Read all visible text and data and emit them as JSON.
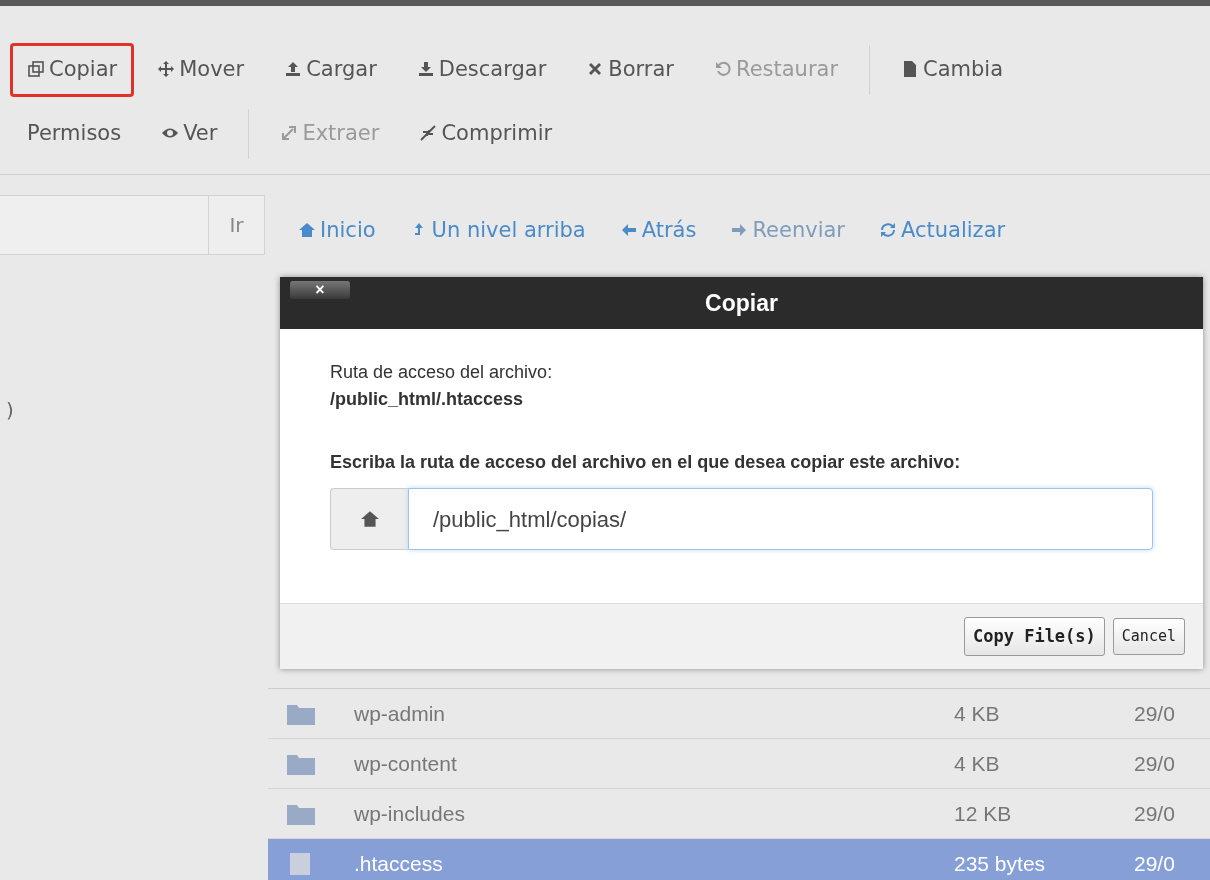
{
  "toolbar": {
    "rows": [
      [
        {
          "label": "Copiar",
          "kind": "copy",
          "disabled": false,
          "highlighted": true
        },
        {
          "label": "Mover",
          "kind": "move",
          "disabled": false,
          "highlighted": false
        },
        {
          "label": "Cargar",
          "kind": "upload",
          "disabled": false,
          "highlighted": false
        },
        {
          "label": "Descargar",
          "kind": "download",
          "disabled": false,
          "highlighted": false
        },
        {
          "label": "Borrar",
          "kind": "delete",
          "disabled": false,
          "highlighted": false
        },
        {
          "label": "Restaurar",
          "kind": "restore",
          "disabled": true,
          "highlighted": false
        },
        {
          "label": "Cambia",
          "kind": "file",
          "disabled": false,
          "highlighted": false
        }
      ],
      [
        {
          "label": "Permisos",
          "kind": "permissions",
          "disabled": false,
          "highlighted": false
        },
        {
          "label": "Ver",
          "kind": "view",
          "disabled": false,
          "highlighted": false
        },
        {
          "label": "Extraer",
          "kind": "extract",
          "disabled": true,
          "highlighted": false
        },
        {
          "label": "Comprimir",
          "kind": "compress",
          "disabled": false,
          "highlighted": false
        }
      ]
    ]
  },
  "sidebar": {
    "go_button": "Ir",
    "tree_text": ")"
  },
  "nav": [
    {
      "label": "Inicio",
      "kind": "home",
      "disabled": false
    },
    {
      "label": "Un nivel arriba",
      "kind": "up",
      "disabled": false
    },
    {
      "label": "Atrás",
      "kind": "back",
      "disabled": false
    },
    {
      "label": "Reenviar",
      "kind": "forward",
      "disabled": true
    },
    {
      "label": "Actualizar",
      "kind": "refresh",
      "disabled": false
    }
  ],
  "dialog": {
    "title": "Copiar",
    "close": "×",
    "source_label": "Ruta de acceso del archivo:",
    "source_path": "/public_html/.htaccess",
    "target_label": "Escriba la ruta de acceso del archivo en el que desea copiar este archivo:",
    "target_value": "/public_html/copias/",
    "buttons": [
      "Copy File(s)",
      "Cancel"
    ]
  },
  "files": [
    {
      "name": "wp-admin",
      "kind": "folder",
      "size": "4 KB",
      "date": "29/0",
      "selected": false
    },
    {
      "name": "wp-content",
      "kind": "folder",
      "size": "4 KB",
      "date": "29/0",
      "selected": false
    },
    {
      "name": "wp-includes",
      "kind": "folder",
      "size": "12 KB",
      "date": "29/0",
      "selected": false
    },
    {
      "name": ".htaccess",
      "kind": "file",
      "size": "235 bytes",
      "date": "29/0",
      "selected": true
    }
  ]
}
